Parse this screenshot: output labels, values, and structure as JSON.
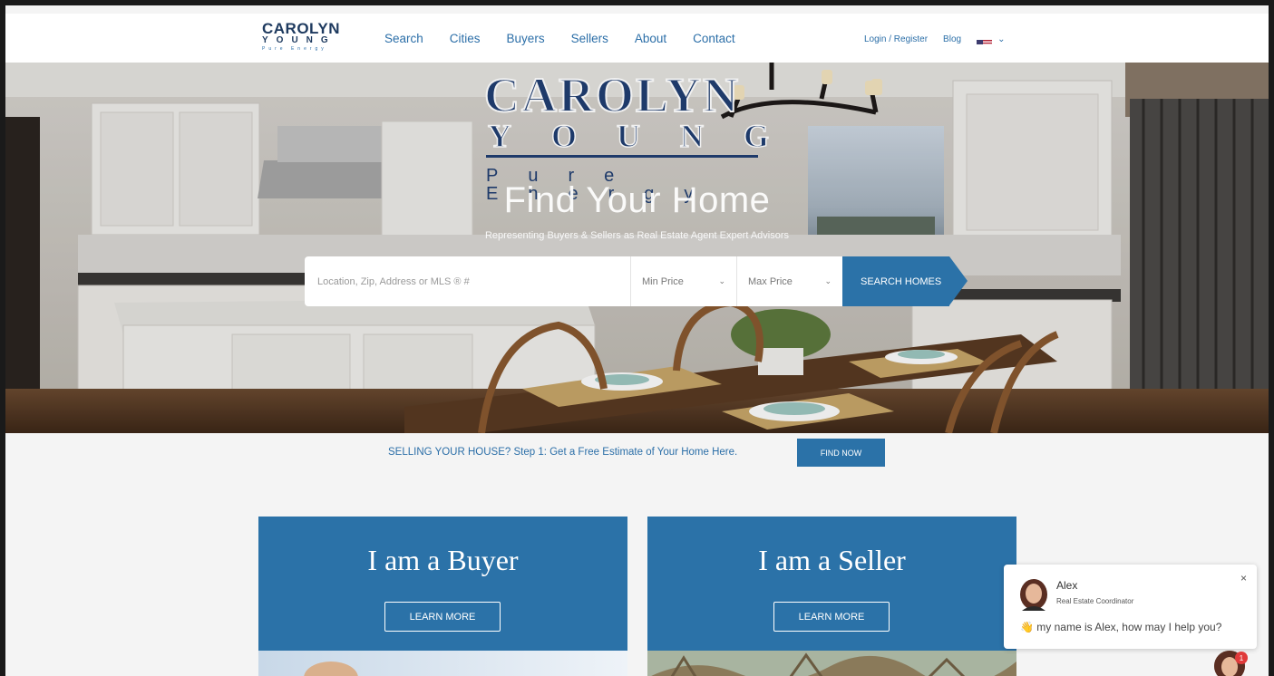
{
  "header": {
    "logo": {
      "line1": "CAROLYN",
      "line2": "YOUNG",
      "line3": "Pure Energy"
    },
    "nav": [
      "Search",
      "Cities",
      "Buyers",
      "Sellers",
      "About",
      "Contact"
    ],
    "login": "Login / Register",
    "blog": "Blog",
    "language_icon": "us-flag-icon"
  },
  "hero": {
    "logo": {
      "line1": "CAROLYN",
      "line2": "YOUNG",
      "line3": "Pure Energy"
    },
    "title": "Find Your Home",
    "subtitle": "Representing Buyers & Sellers as Real Estate Agent Expert Advisors",
    "search": {
      "placeholder": "Location, Zip, Address or MLS ® #",
      "min_price": "Min Price",
      "max_price": "Max Price",
      "button": "SEARCH HOMES"
    }
  },
  "estimate": {
    "text": "SELLING YOUR HOUSE?  Step 1: Get a Free Estimate of Your Home Here.",
    "button": "FIND NOW"
  },
  "cards": [
    {
      "title": "I am a Buyer",
      "button": "LEARN MORE"
    },
    {
      "title": "I am a Seller",
      "button": "LEARN MORE"
    }
  ],
  "chat": {
    "name": "Alex",
    "role": "Real Estate Coordinator",
    "message": "👋 my name is Alex, how may I help you?",
    "close": "×",
    "badge": "1"
  },
  "colors": {
    "brand_blue": "#2b72a8",
    "navy": "#1e3a6a",
    "link": "#2c6fa8"
  }
}
